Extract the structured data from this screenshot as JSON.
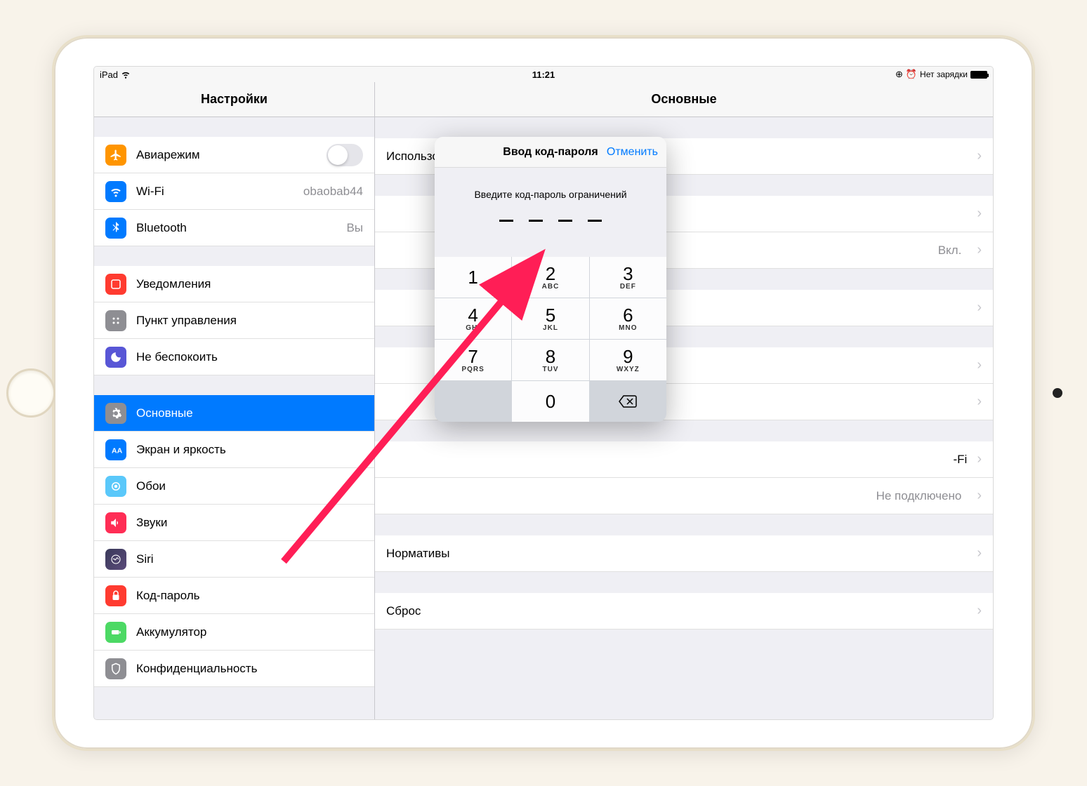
{
  "status_bar": {
    "device": "iPad",
    "time": "11:21",
    "charging": "Нет зарядки"
  },
  "sidebar": {
    "title": "Настройки",
    "groups": [
      [
        {
          "label": "Авиарежим",
          "icon": "airplane",
          "name": "airplane",
          "toggle": true
        },
        {
          "label": "Wi-Fi",
          "icon": "wifi",
          "name": "wifi",
          "value": "obaobab44"
        },
        {
          "label": "Bluetooth",
          "icon": "bluetooth",
          "name": "bluetooth",
          "value": "Вы"
        }
      ],
      [
        {
          "label": "Уведомления",
          "icon": "notify",
          "name": "notifications"
        },
        {
          "label": "Пункт управления",
          "icon": "control",
          "name": "control-center"
        },
        {
          "label": "Не беспокоить",
          "icon": "dnd",
          "name": "do-not-disturb"
        }
      ],
      [
        {
          "label": "Основные",
          "icon": "general",
          "name": "general",
          "selected": true
        },
        {
          "label": "Экран и яркость",
          "icon": "display",
          "name": "display"
        },
        {
          "label": "Обои",
          "icon": "wallpaper",
          "name": "wallpaper"
        },
        {
          "label": "Звуки",
          "icon": "sounds",
          "name": "sounds"
        },
        {
          "label": "Siri",
          "icon": "siri",
          "name": "siri"
        },
        {
          "label": "Код-пароль",
          "icon": "passcode",
          "name": "passcode"
        },
        {
          "label": "Аккумулятор",
          "icon": "battery",
          "name": "battery"
        },
        {
          "label": "Конфиденциальность",
          "icon": "privacy",
          "name": "privacy"
        }
      ]
    ]
  },
  "detail": {
    "title": "Основные",
    "row_storage": "Использование хранилища и iCloud",
    "row_restrictions_value": "Вкл.",
    "row_wifi_suffix": "-Fi",
    "row_vpn_value": "Не подключено",
    "row_regs": "Нормативы",
    "row_reset": "Сброс"
  },
  "modal": {
    "header": "Ввод код-пароля",
    "cancel": "Отменить",
    "prompt": "Введите код-пароль ограничений",
    "keypad": [
      {
        "num": "1",
        "letters": ""
      },
      {
        "num": "2",
        "letters": "ABC"
      },
      {
        "num": "3",
        "letters": "DEF"
      },
      {
        "num": "4",
        "letters": "GHI"
      },
      {
        "num": "5",
        "letters": "JKL"
      },
      {
        "num": "6",
        "letters": "MNO"
      },
      {
        "num": "7",
        "letters": "PQRS"
      },
      {
        "num": "8",
        "letters": "TUV"
      },
      {
        "num": "9",
        "letters": "WXYZ"
      },
      {
        "num": "0",
        "letters": ""
      }
    ]
  }
}
